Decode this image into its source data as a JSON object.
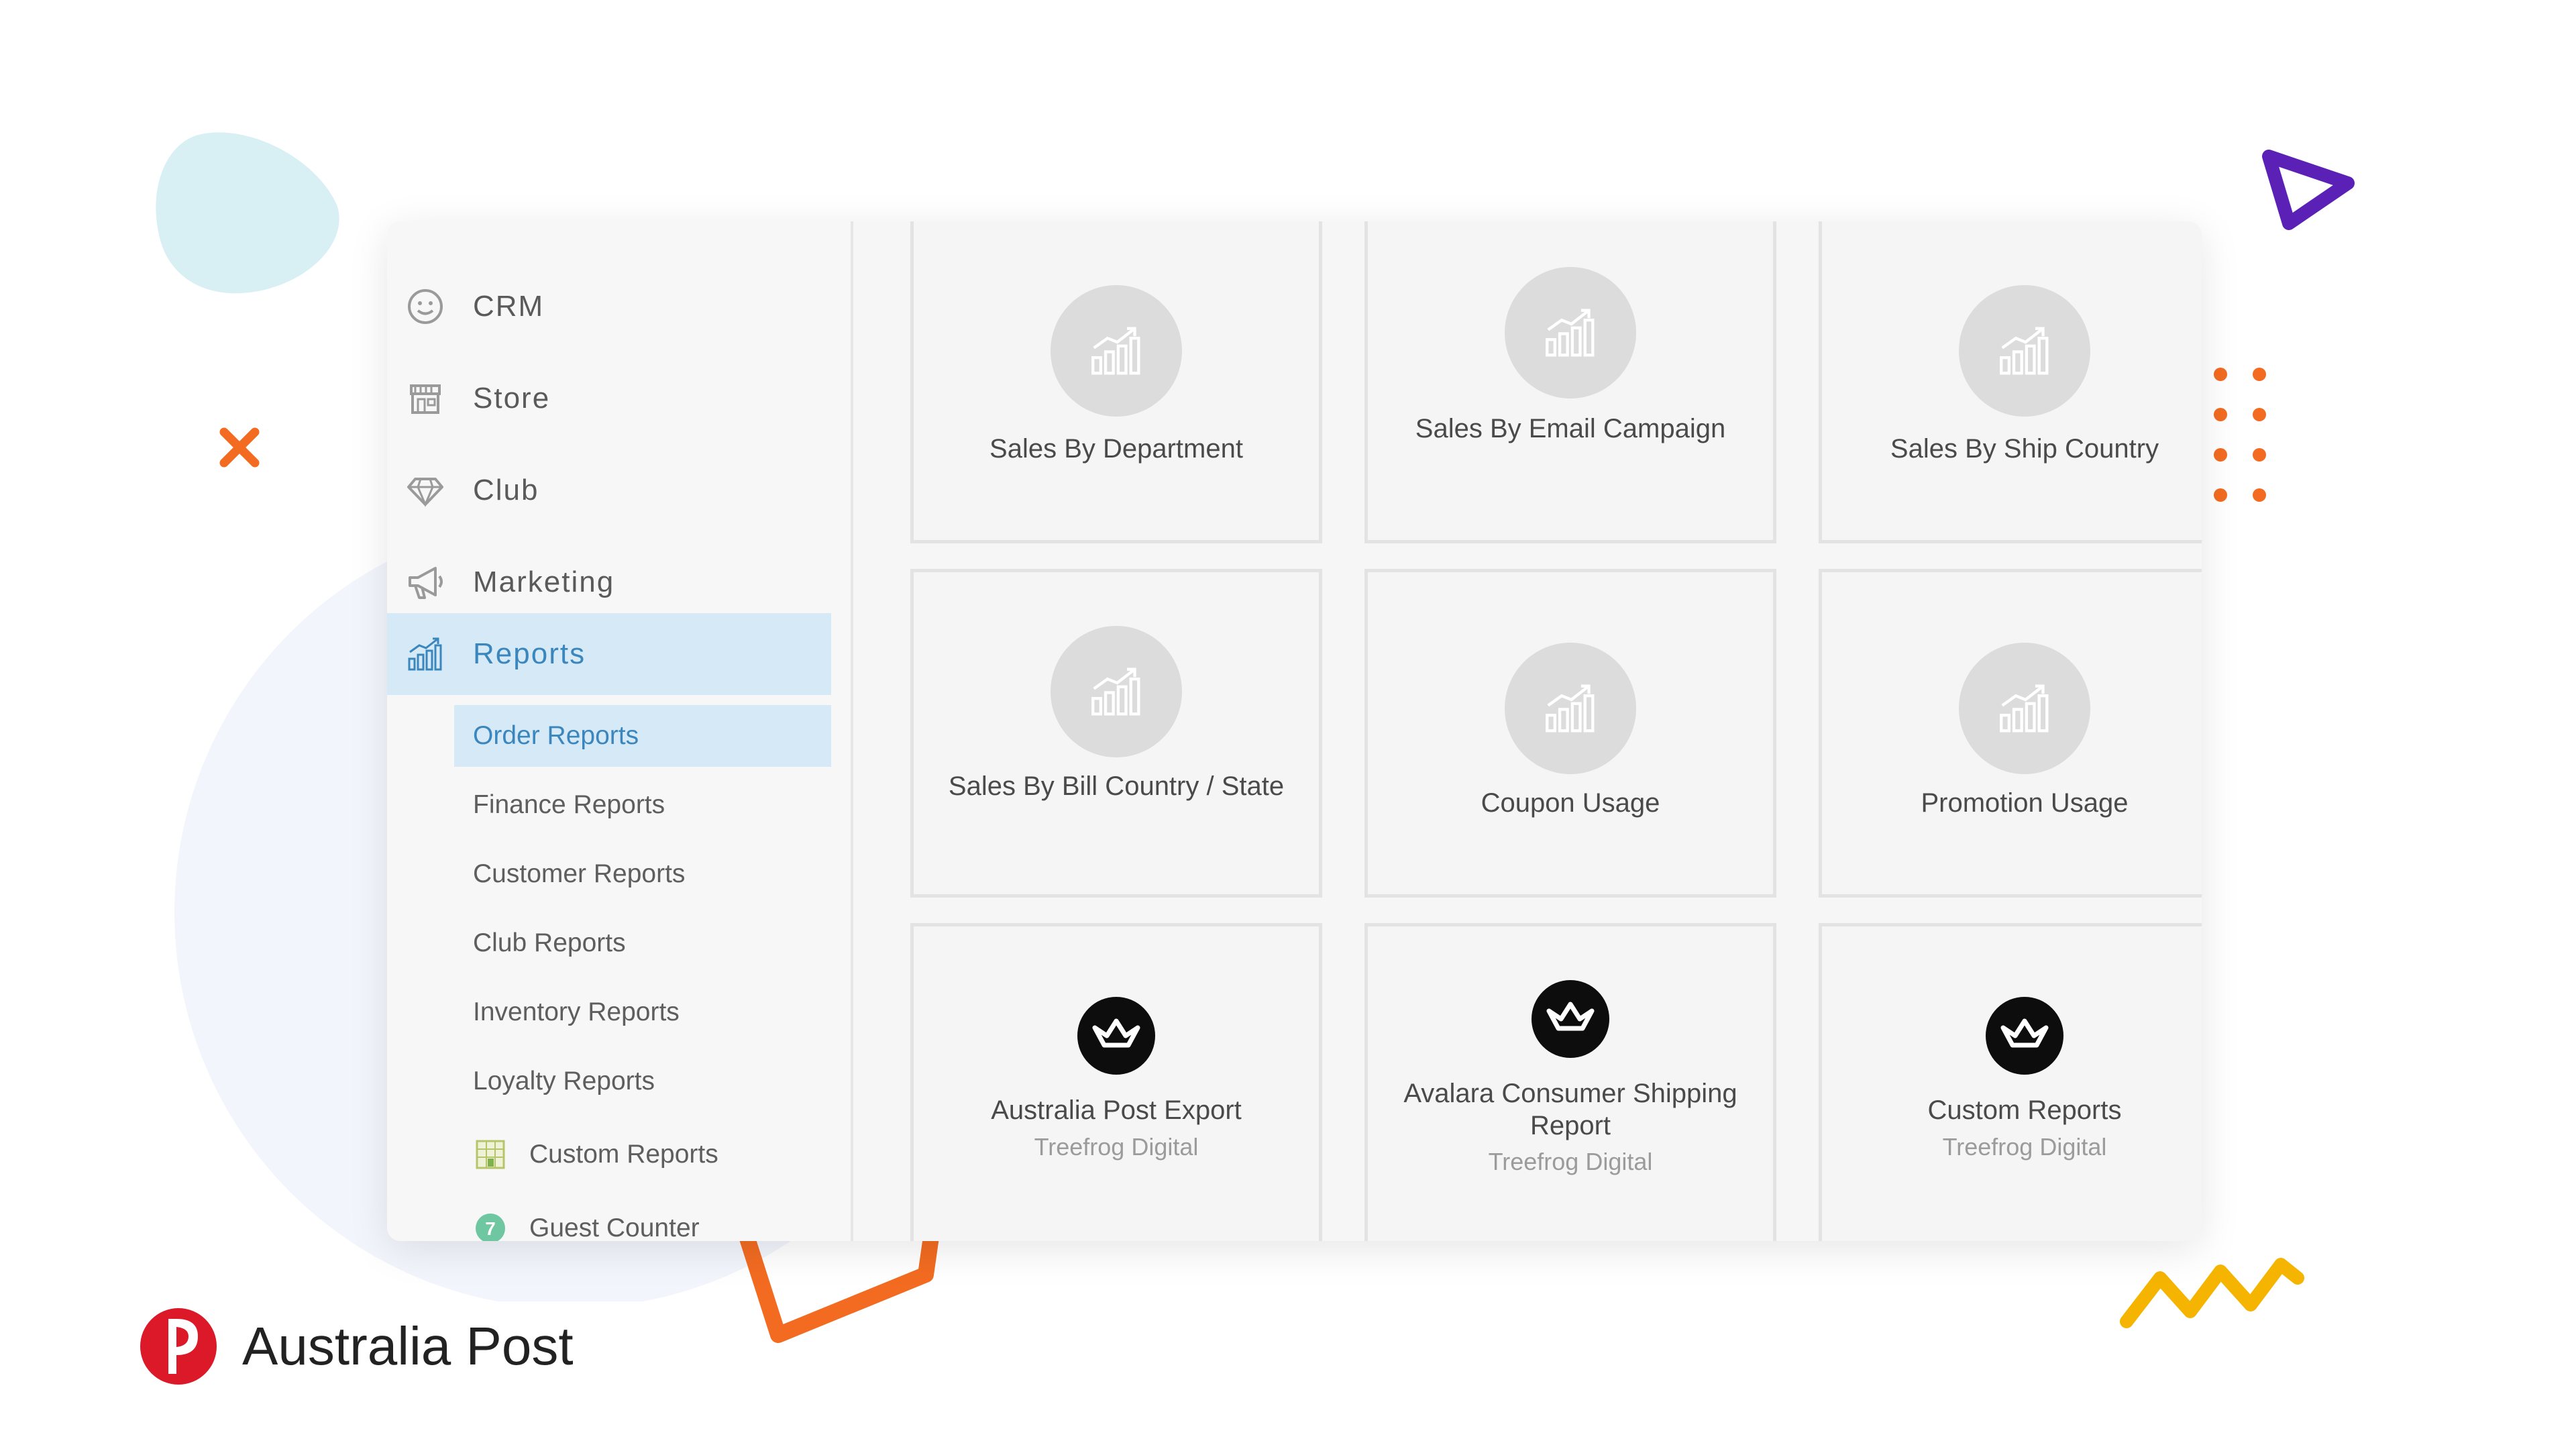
{
  "sidebar": {
    "items": [
      {
        "label": "CRM",
        "icon": "smiley-icon"
      },
      {
        "label": "Store",
        "icon": "store-icon"
      },
      {
        "label": "Club",
        "icon": "diamond-icon"
      },
      {
        "label": "Marketing",
        "icon": "megaphone-icon"
      },
      {
        "label": "Reports",
        "icon": "bar-chart-icon",
        "active": true
      }
    ],
    "subitems": [
      {
        "label": "Order Reports",
        "active": true
      },
      {
        "label": "Finance Reports"
      },
      {
        "label": "Customer Reports"
      },
      {
        "label": "Club Reports"
      },
      {
        "label": "Inventory Reports"
      },
      {
        "label": "Loyalty Reports"
      },
      {
        "label": "Custom Reports",
        "icon": "spreadsheet-icon"
      },
      {
        "label": "Guest Counter",
        "icon": "guest-counter-icon",
        "icon_text": "7"
      }
    ]
  },
  "cards": [
    {
      "title": "Sales By Department",
      "icon": "bar-chart-icon"
    },
    {
      "title": "Sales By Email Campaign",
      "icon": "bar-chart-icon"
    },
    {
      "title": "Sales By Ship Country",
      "icon": "bar-chart-icon"
    },
    {
      "title": "Sales By Bill Country / State",
      "icon": "bar-chart-icon"
    },
    {
      "title": "Coupon Usage",
      "icon": "bar-chart-icon"
    },
    {
      "title": "Promotion Usage",
      "icon": "bar-chart-icon"
    },
    {
      "title": "Australia Post Export",
      "subtitle": "Treefrog Digital",
      "icon": "treefrog-crown-icon"
    },
    {
      "title": "Avalara Consumer Shipping Report",
      "subtitle": "Treefrog Digital",
      "icon": "treefrog-crown-icon"
    },
    {
      "title": "Custom Reports",
      "subtitle": "Treefrog Digital",
      "icon": "treefrog-crown-icon"
    }
  ],
  "brand": {
    "name": "Australia Post",
    "logo": "australia-post-logo"
  },
  "colors": {
    "active_bg": "#d6e9f6",
    "active_text": "#3a86bd",
    "orange": "#f26b21",
    "purple": "#5b21b6",
    "yellow": "#f5b400",
    "brand_red": "#dc1928"
  }
}
